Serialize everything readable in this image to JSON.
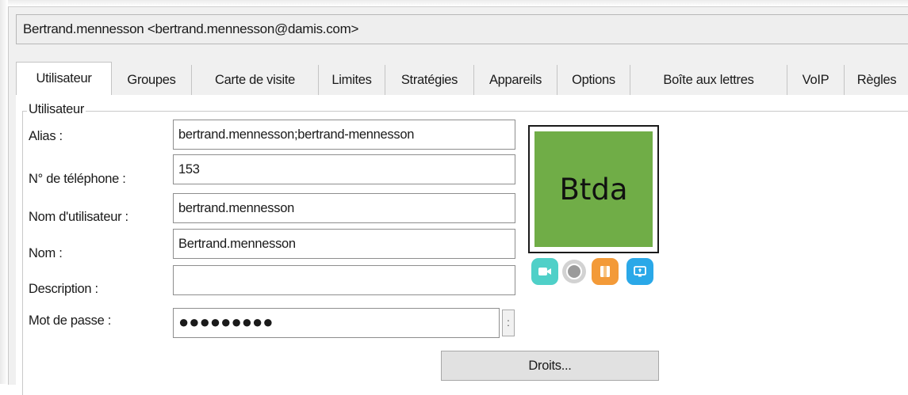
{
  "header": {
    "account": "Bertrand.mennesson <bertrand.mennesson@damis.com>"
  },
  "tabs": [
    {
      "label": "Utilisateur",
      "active": true
    },
    {
      "label": "Groupes",
      "active": false
    },
    {
      "label": "Carte de visite",
      "active": false
    },
    {
      "label": "Limites",
      "active": false
    },
    {
      "label": "Stratégies",
      "active": false
    },
    {
      "label": "Appareils",
      "active": false
    },
    {
      "label": "Options",
      "active": false
    },
    {
      "label": "Boîte aux lettres",
      "active": false
    },
    {
      "label": "VoIP",
      "active": false
    },
    {
      "label": "Règles",
      "active": false
    }
  ],
  "group": {
    "title": "Utilisateur"
  },
  "form": {
    "alias_label": "Alias :",
    "alias_value": "bertrand.mennesson;bertrand-mennesson",
    "phone_label": "N° de téléphone :",
    "phone_value": "153",
    "username_label": "Nom d'utilisateur :",
    "username_value": "bertrand.mennesson",
    "name_label": "Nom :",
    "name_value": "Bertrand.mennesson",
    "description_label": "Description :",
    "description_value": "",
    "password_label": "Mot de passe :",
    "password_value": "●●●●●●●●●",
    "password_button": ":"
  },
  "avatar": {
    "text": "Btda",
    "color": "#70ad47"
  },
  "presence_icons": [
    "video-call-icon",
    "status-icon",
    "contact-card-icon",
    "screen-share-icon"
  ],
  "actions": {
    "rights_label": "Droits..."
  }
}
